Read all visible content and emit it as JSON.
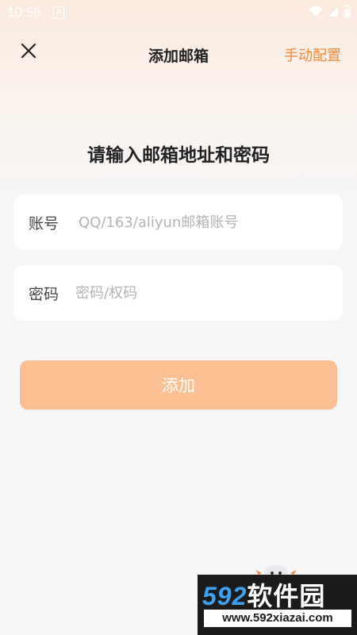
{
  "status_bar": {
    "time": "10:58",
    "notification_letter": "A",
    "icons": [
      "wifi-icon",
      "signal-icon",
      "battery-icon"
    ]
  },
  "header": {
    "title": "添加邮箱",
    "close_icon": "close-icon",
    "manual_config_label": "手动配置"
  },
  "main": {
    "heading": "请输入邮箱地址和密码",
    "account": {
      "label": "账号",
      "value": "",
      "placeholder": "QQ/163/aliyun邮箱账号"
    },
    "password": {
      "label": "密码",
      "value": "",
      "placeholder": "密码/权码"
    },
    "add_button_label": "添加"
  },
  "watermark": {
    "brand_digits": "592",
    "brand_text": "软件园",
    "url": "www.592xiazai.com"
  },
  "colors": {
    "accent": "#f08a3c",
    "button_disabled": "#fbbf93",
    "background": "#f6f6f6",
    "watermark_blue": "#3da1f0"
  }
}
